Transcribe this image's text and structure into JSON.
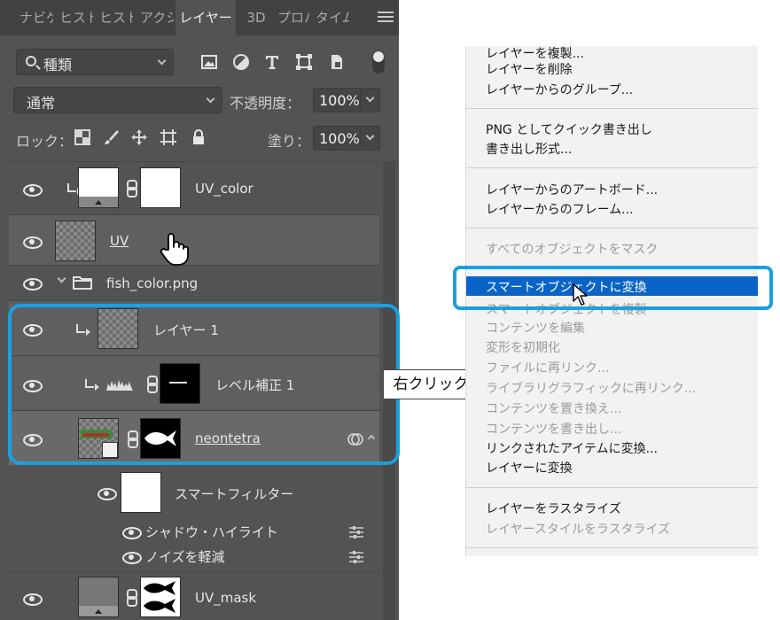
{
  "tabs": [
    "ナビゲ",
    "ヒスト",
    "ヒスト",
    "アクシ",
    "レイヤー",
    "3D",
    "プロパ",
    "タイム"
  ],
  "active_tab_index": 4,
  "filter": {
    "value": "種類"
  },
  "blend_mode": "通常",
  "opacity": {
    "label": "不透明度：",
    "value": "100%"
  },
  "lock": {
    "label": "ロック："
  },
  "fill": {
    "label": "塗り：",
    "value": "100%"
  },
  "layers": [
    {
      "name": "UV_color",
      "clipped": true,
      "mask": true
    },
    {
      "name": "UV",
      "clipped": false,
      "mask": false
    },
    {
      "name": "fish_color.png",
      "type": "group"
    },
    {
      "name": "レイヤー 1",
      "clipped": true
    },
    {
      "name": "レベル補正 1",
      "clipped": true,
      "type": "adjustment"
    },
    {
      "name": "neontetra",
      "type": "smart-object"
    },
    {
      "name": "スマートフィルター",
      "type": "smart-filter"
    },
    {
      "name": "シャドウ・ハイライト",
      "type": "filter"
    },
    {
      "name": "ノイズを軽減",
      "type": "filter"
    },
    {
      "name": "UV_mask",
      "mask": true
    }
  ],
  "right_click_label": "右クリック",
  "context_menu": {
    "items": [
      {
        "label": "レイヤーを複製...",
        "enabled": true
      },
      {
        "label": "レイヤーを削除",
        "enabled": true
      },
      {
        "label": "レイヤーからのグループ...",
        "enabled": true
      },
      {
        "label": "PNG としてクイック書き出し",
        "enabled": true
      },
      {
        "label": "書き出し形式...",
        "enabled": true
      },
      {
        "label": "レイヤーからのアートボード...",
        "enabled": true
      },
      {
        "label": "レイヤーからのフレーム...",
        "enabled": true
      },
      {
        "label": "すべてのオブジェクトをマスク",
        "enabled": false
      },
      {
        "label": "スマートオブジェクトに変換",
        "enabled": true,
        "highlighted": true
      },
      {
        "label": "スマートオブジェクトを複製",
        "enabled": false
      },
      {
        "label": "コンテンツを編集",
        "enabled": false
      },
      {
        "label": "変形を初期化",
        "enabled": false
      },
      {
        "label": "ファイルに再リンク...",
        "enabled": false
      },
      {
        "label": "ライブラリグラフィックに再リンク...",
        "enabled": false
      },
      {
        "label": "コンテンツを置き換え...",
        "enabled": false
      },
      {
        "label": "コンテンツを書き出し...",
        "enabled": false
      },
      {
        "label": "リンクされたアイテムに変換...",
        "enabled": true
      },
      {
        "label": "レイヤーに変換",
        "enabled": true
      },
      {
        "label": "レイヤーをラスタライズ",
        "enabled": true
      },
      {
        "label": "レイヤースタイルをラスタライズ",
        "enabled": false
      }
    ]
  },
  "colors": {
    "panel_bg": "#535353",
    "accent_blue": "#1aa0e0",
    "menu_highlight": "#0a64c8"
  }
}
